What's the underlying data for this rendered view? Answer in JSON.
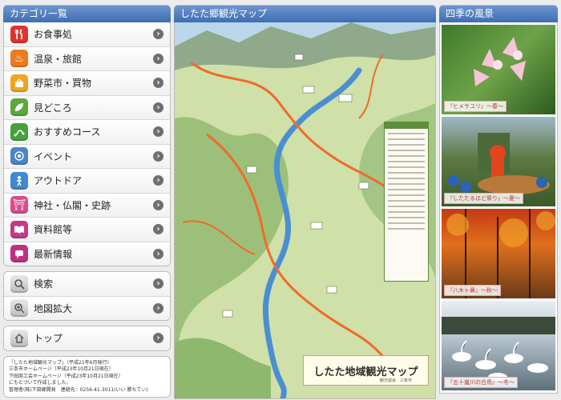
{
  "left": {
    "header": "カテゴリ一覧",
    "menu": [
      {
        "label": "お食事処",
        "icon": "fork-knife-icon",
        "color": "#d9362e"
      },
      {
        "label": "温泉・旅館",
        "icon": "hot-spring-icon",
        "color": "#ec7a1e"
      },
      {
        "label": "野菜市・買物",
        "icon": "shopping-basket-icon",
        "color": "#f0a51f"
      },
      {
        "label": "見どころ",
        "icon": "leaf-icon",
        "color": "#5aa93a"
      },
      {
        "label": "おすすめコース",
        "icon": "route-icon",
        "color": "#47a03b"
      },
      {
        "label": "イベント",
        "icon": "event-icon",
        "color": "#4a86c8"
      },
      {
        "label": "アウトドア",
        "icon": "outdoor-person-icon",
        "color": "#3f89d0"
      },
      {
        "label": "神社・仏閣・史跡",
        "icon": "torii-gate-icon",
        "color": "#d94c8d"
      },
      {
        "label": "資料館等",
        "icon": "book-icon",
        "color": "#c33a86"
      },
      {
        "label": "最新情報",
        "icon": "chat-bubble-icon",
        "color": "#c0307f"
      }
    ],
    "tools": [
      {
        "label": "検索",
        "icon": "search-icon"
      },
      {
        "label": "地図拡大",
        "icon": "zoom-icon"
      }
    ],
    "top": {
      "label": "トップ",
      "icon": "home-icon"
    },
    "info_lines": [
      "「したた地域観光マップ」（平成21年6月発行）",
      "三条市ホームページ（平成23年10月21日現在）",
      "下田商工会ホームページ（平成23年10月21日現在）",
      "にもとづいて作成しました。",
      "管理者(株)下田郷開発　連絡先：0256-41-3011(いい 勝ちてぃ)"
    ]
  },
  "center": {
    "header": "したた郷観光マップ",
    "map_title": "したた地域観光マップ",
    "map_subtitle": "観光協会　三条市"
  },
  "right": {
    "header": "四季の風景",
    "photos": [
      {
        "caption": "『ヒメサユリ』〜春〜",
        "name": "spring-photo"
      },
      {
        "caption": "『したたるほど祭り』〜夏〜",
        "name": "summer-photo"
      },
      {
        "caption": "『八木ヶ鼻』〜秋〜",
        "name": "autumn-photo"
      },
      {
        "caption": "『五十嵐川の白鳥』〜冬〜",
        "name": "winter-photo"
      }
    ]
  }
}
